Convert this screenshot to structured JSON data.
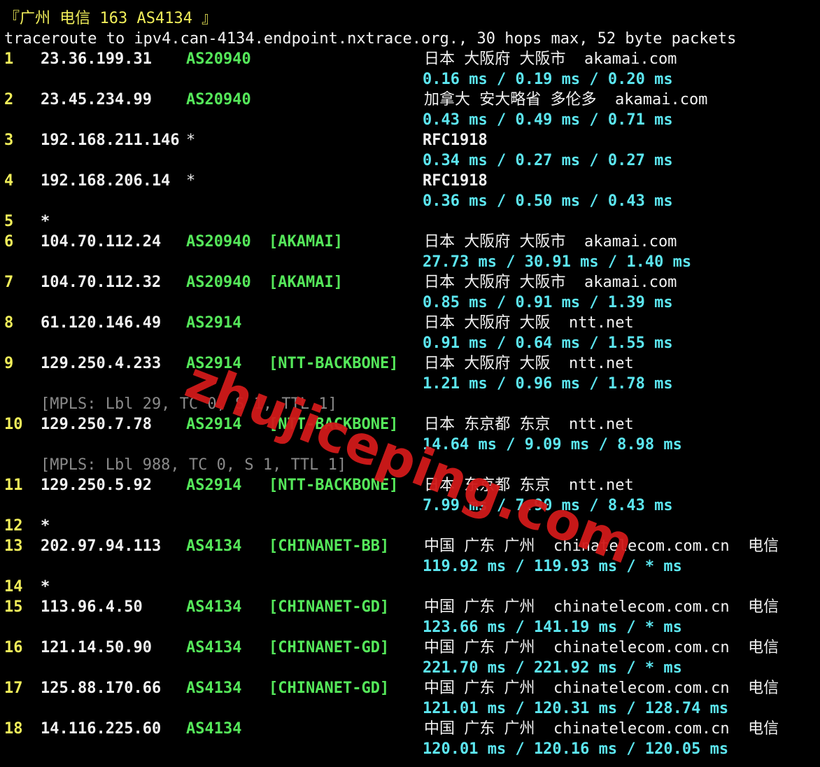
{
  "header": "『广州 电信 163 AS4134 』",
  "command": "traceroute to ipv4.can-4134.endpoint.nxtrace.org., 30 hops max, 52 byte packets",
  "hops": [
    {
      "n": "1",
      "ip": "23.36.199.31",
      "as": "AS20940",
      "tag": "",
      "geo": "日本 大阪府 大阪市  akamai.com",
      "rtt": "0.16 ms / 0.19 ms / 0.20 ms"
    },
    {
      "n": "2",
      "ip": "23.45.234.99",
      "as": "AS20940",
      "tag": "",
      "geo": "加拿大 安大略省 多伦多  akamai.com",
      "rtt": "0.43 ms / 0.49 ms / 0.71 ms"
    },
    {
      "n": "3",
      "ip": "192.168.211.146",
      "as": "*",
      "tag": "",
      "geo": "RFC1918",
      "rtt": "0.34 ms / 0.27 ms / 0.27 ms"
    },
    {
      "n": "4",
      "ip": "192.168.206.14",
      "as": "*",
      "tag": "",
      "geo": "RFC1918",
      "rtt": "0.36 ms / 0.50 ms / 0.43 ms"
    },
    {
      "n": "5",
      "ip": "*",
      "as": "",
      "tag": "",
      "geo": "",
      "rtt": ""
    },
    {
      "n": "6",
      "ip": "104.70.112.24",
      "as": "AS20940",
      "tag": "[AKAMAI]",
      "geo": "日本 大阪府 大阪市  akamai.com",
      "rtt": "27.73 ms / 30.91 ms / 1.40 ms"
    },
    {
      "n": "7",
      "ip": "104.70.112.32",
      "as": "AS20940",
      "tag": "[AKAMAI]",
      "geo": "日本 大阪府 大阪市  akamai.com",
      "rtt": "0.85 ms / 0.91 ms / 1.39 ms"
    },
    {
      "n": "8",
      "ip": "61.120.146.49",
      "as": "AS2914",
      "tag": "",
      "geo": "日本 大阪府 大阪  ntt.net",
      "rtt": "0.91 ms / 0.64 ms / 1.55 ms"
    },
    {
      "n": "9",
      "ip": "129.250.4.233",
      "as": "AS2914",
      "tag": "[NTT-BACKBONE]",
      "geo": "日本 大阪府 大阪  ntt.net",
      "rtt": "1.21 ms / 0.96 ms / 1.78 ms",
      "mpls": "[MPLS: Lbl 29, TC 0, S 1, TTL 1]"
    },
    {
      "n": "10",
      "ip": "129.250.7.78",
      "as": "AS2914",
      "tag": "[NTT-BACKBONE]",
      "geo": "日本 东京都 东京  ntt.net",
      "rtt": "14.64 ms / 9.09 ms / 8.98 ms",
      "mpls": "[MPLS: Lbl 988, TC 0, S 1, TTL 1]"
    },
    {
      "n": "11",
      "ip": "129.250.5.92",
      "as": "AS2914",
      "tag": "[NTT-BACKBONE]",
      "geo": "日本 东京都 东京  ntt.net",
      "rtt": "7.99 ms / 7.90 ms / 8.43 ms"
    },
    {
      "n": "12",
      "ip": "*",
      "as": "",
      "tag": "",
      "geo": "",
      "rtt": ""
    },
    {
      "n": "13",
      "ip": "202.97.94.113",
      "as": "AS4134",
      "tag": "[CHINANET-BB]",
      "geo": "中国 广东 广州  chinatelecom.com.cn  电信",
      "rtt": "119.92 ms / 119.93 ms / * ms"
    },
    {
      "n": "14",
      "ip": "*",
      "as": "",
      "tag": "",
      "geo": "",
      "rtt": ""
    },
    {
      "n": "15",
      "ip": "113.96.4.50",
      "as": "AS4134",
      "tag": "[CHINANET-GD]",
      "geo": "中国 广东 广州  chinatelecom.com.cn  电信",
      "rtt": "123.66 ms / 141.19 ms / * ms"
    },
    {
      "n": "16",
      "ip": "121.14.50.90",
      "as": "AS4134",
      "tag": "[CHINANET-GD]",
      "geo": "中国 广东 广州  chinatelecom.com.cn  电信",
      "rtt": "221.70 ms / 221.92 ms / * ms"
    },
    {
      "n": "17",
      "ip": "125.88.170.66",
      "as": "AS4134",
      "tag": "[CHINANET-GD]",
      "geo": "中国 广东 广州  chinatelecom.com.cn  电信",
      "rtt": "121.01 ms / 120.31 ms / 128.74 ms"
    },
    {
      "n": "18",
      "ip": "14.116.225.60",
      "as": "AS4134",
      "tag": "",
      "geo": "中国 广东 广州  chinatelecom.com.cn  电信",
      "rtt": "120.01 ms / 120.16 ms / 120.05 ms"
    }
  ],
  "watermark": "zhujiceping.com",
  "colors": {
    "background": "#000000",
    "hop_number": "#f2ef5a",
    "asn": "#55e85a",
    "rtt": "#5ce6f0",
    "mpls": "#8a8a8a"
  }
}
